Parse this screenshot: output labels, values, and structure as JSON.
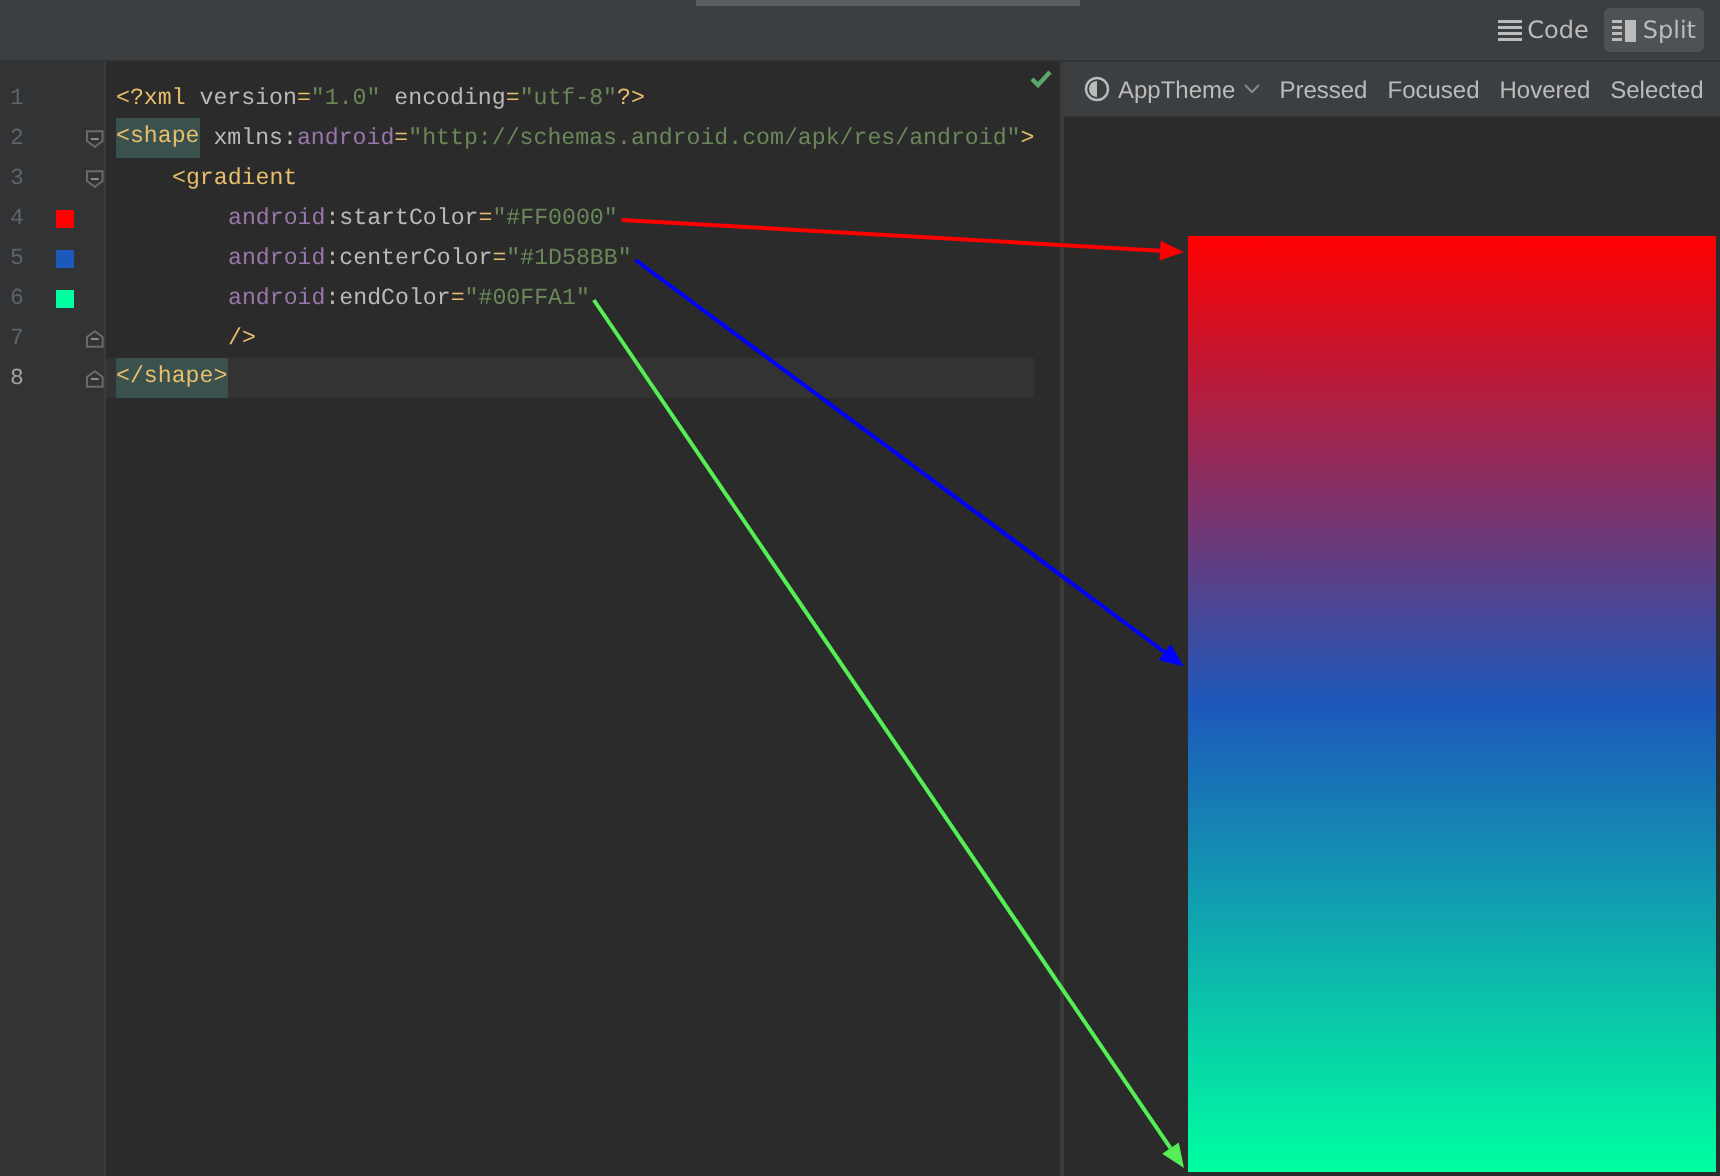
{
  "view_modes": [
    {
      "label": "Code",
      "selected": false
    },
    {
      "label": "Split",
      "selected": true
    }
  ],
  "editor": {
    "valid": true,
    "lines": [
      {
        "number": "1",
        "kind": "plain",
        "tokens": [
          {
            "kind": "punct",
            "text": "<?"
          },
          {
            "kind": "tag",
            "text": "xml"
          },
          {
            "kind": "attr",
            "gap": true,
            "text": "version"
          },
          {
            "kind": "punct",
            "text": "="
          },
          {
            "kind": "value",
            "text": "\"1.0\""
          },
          {
            "kind": "attr",
            "gap": true,
            "text": "encoding"
          },
          {
            "kind": "punct",
            "text": "="
          },
          {
            "kind": "value",
            "text": "\"utf-8\""
          },
          {
            "kind": "punct",
            "text": "?>"
          }
        ]
      },
      {
        "number": "2",
        "kind": "fold-start",
        "tokens": [
          {
            "kind": "tag-match",
            "text": "<shape"
          },
          {
            "kind": "attr",
            "gap": true,
            "text": "xmlns:"
          },
          {
            "kind": "ns",
            "text": "android"
          },
          {
            "kind": "punct",
            "text": "="
          },
          {
            "kind": "value",
            "text": "\"http://schemas.android.com/apk/res/android\""
          },
          {
            "kind": "punct",
            "text": ">"
          }
        ],
        "children": [
          {
            "number": "3",
            "kind": "fold-start",
            "tokens": [
              {
                "kind": "tag",
                "text": "<gradient"
              }
            ],
            "children": [
              {
                "number": "4",
                "kind": "plain",
                "color": "#ff0000",
                "arrow": {
                  "color": "#ff0000",
                  "kind": "top"
                },
                "tokens": [
                  {
                    "kind": "ns",
                    "text": "android"
                  },
                  {
                    "kind": "attr",
                    "text": ":startColor"
                  },
                  {
                    "kind": "punct",
                    "text": "="
                  },
                  {
                    "kind": "value",
                    "text": "\"#FF0000\""
                  }
                ]
              },
              {
                "number": "5",
                "kind": "plain",
                "color": "#1d58bb",
                "arrow": {
                  "color": "#0000ff",
                  "kind": "center"
                },
                "tokens": [
                  {
                    "kind": "ns",
                    "text": "android"
                  },
                  {
                    "kind": "attr",
                    "text": ":centerColor"
                  },
                  {
                    "kind": "punct",
                    "text": "="
                  },
                  {
                    "kind": "value",
                    "text": "\"#1D58BB\""
                  }
                ]
              },
              {
                "number": "6",
                "kind": "plain",
                "color": "#00ffa1",
                "arrow": {
                  "color": "#55ee55",
                  "kind": "bottom"
                },
                "tokens": [
                  {
                    "kind": "ns",
                    "text": "android"
                  },
                  {
                    "kind": "attr",
                    "text": ":endColor"
                  },
                  {
                    "kind": "punct",
                    "text": "="
                  },
                  {
                    "kind": "value",
                    "text": "\"#00FFA1\""
                  }
                ]
              },
              {
                "number": "7",
                "kind": "fold-end",
                "tokens": [
                  {
                    "kind": "tag",
                    "text": "/>"
                  }
                ]
              }
            ]
          }
        ]
      },
      {
        "number": "8",
        "kind": "fold-end",
        "current": true,
        "tokens": [
          {
            "kind": "tag-match",
            "text": "</shape>"
          }
        ]
      }
    ]
  },
  "preview": {
    "theme": "AppTheme",
    "states": [
      "Pressed",
      "Focused",
      "Hovered",
      "Selected"
    ],
    "gradient": {
      "stops": [
        {
          "color": "#ff0000"
        },
        {
          "color": "#1d58bb"
        },
        {
          "color": "#00ffa1"
        }
      ]
    }
  }
}
